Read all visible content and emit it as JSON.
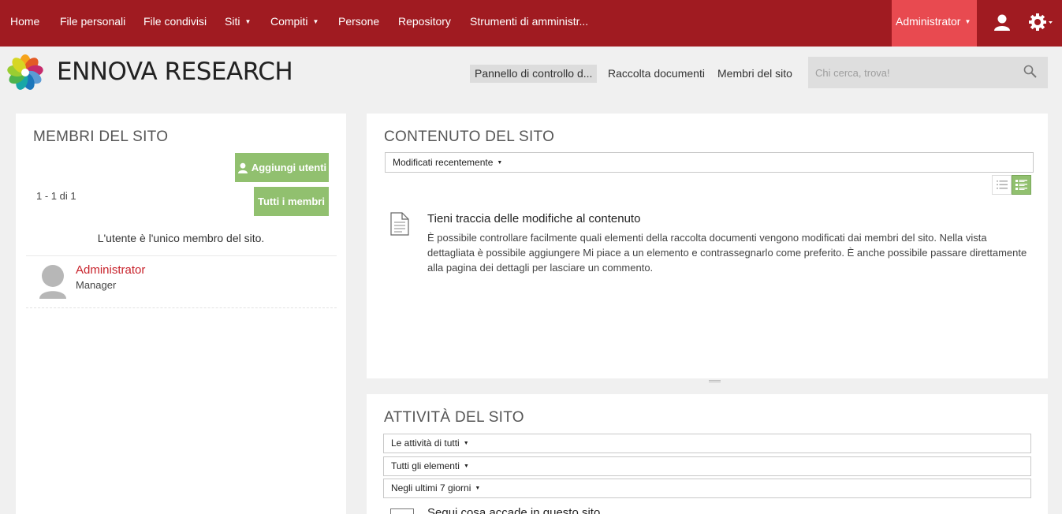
{
  "nav": {
    "items": [
      {
        "label": "Home",
        "dropdown": false
      },
      {
        "label": "File personali",
        "dropdown": false
      },
      {
        "label": "File condivisi",
        "dropdown": false
      },
      {
        "label": "Siti",
        "dropdown": true
      },
      {
        "label": "Compiti",
        "dropdown": true
      },
      {
        "label": "Persone",
        "dropdown": false
      },
      {
        "label": "Repository",
        "dropdown": false
      },
      {
        "label": "Strumenti di amministr...",
        "dropdown": false
      }
    ],
    "user_label": "Administrator",
    "user_icon": "user-icon",
    "settings_icon": "gear-icon",
    "bar_color": "#a01b21",
    "active_color": "#e84a50"
  },
  "header": {
    "logo_icon": "flower-logo-icon",
    "site_name": "ENNOVA RESEARCH",
    "links": [
      {
        "label": "Pannello di controllo d...",
        "active": true
      },
      {
        "label": "Raccolta documenti",
        "active": false
      },
      {
        "label": "Membri del sito",
        "active": false
      }
    ],
    "search_placeholder": "Chi cerca, trova!",
    "search_value": ""
  },
  "members": {
    "title": "MEMBRI DEL SITO",
    "add_users_label": "Aggiungi utenti",
    "all_members_label": "Tutti i membri",
    "count_label": "1 - 1 di 1",
    "only_member_message": "L'utente è l'unico membro del sito.",
    "list": [
      {
        "name": "Administrator",
        "role": "Manager"
      }
    ]
  },
  "content": {
    "title": "CONTENUTO DEL SITO",
    "filter_label": "Modificati recentemente",
    "view_icons": [
      "simple-list-icon",
      "detailed-list-icon"
    ],
    "empty_title": "Tieni traccia delle modifiche al contenuto",
    "empty_text": "È possibile controllare facilmente quali elementi della raccolta documenti vengono modificati dai membri del sito. Nella vista dettagliata è possibile aggiungere Mi piace a un elemento e contrassegnarlo come preferito. È anche possibile passare direttamente alla pagina dei dettagli per lasciare un commento."
  },
  "activities": {
    "title": "ATTIVITÀ DEL SITO",
    "filters": [
      "Le attività di tutti",
      "Tutti gli elementi",
      "Negli ultimi 7 giorni"
    ],
    "empty_title": "Segui cosa accade in questo sito"
  },
  "colors": {
    "accent_green": "#91c06f",
    "link_red": "#c8232c"
  }
}
